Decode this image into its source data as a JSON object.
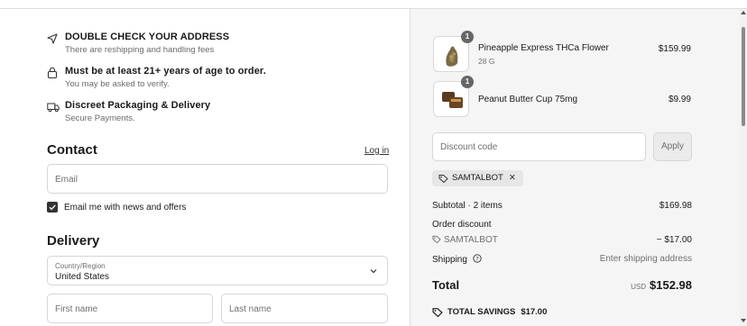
{
  "notices": [
    {
      "icon": "navigation-arrow-icon",
      "title": "DOUBLE CHECK YOUR ADDRESS",
      "subtitle": "There are reshipping and handling fees"
    },
    {
      "icon": "lock-icon",
      "title": "Must be at least 21+ years of age to order.",
      "subtitle": "You may be asked to verify."
    },
    {
      "icon": "truck-icon",
      "title": "Discreet Packaging & Delivery",
      "subtitle": "Secure Payments."
    }
  ],
  "contact": {
    "heading": "Contact",
    "login_label": "Log in",
    "email_placeholder": "Email",
    "newsletter_label": "Email me with news and offers",
    "newsletter_checked": true
  },
  "delivery": {
    "heading": "Delivery",
    "country_label": "Country/Region",
    "country_value": "United States",
    "first_name_placeholder": "First name",
    "last_name_placeholder": "Last name"
  },
  "cart": {
    "items": [
      {
        "name": "Pineapple Express THCa Flower",
        "variant": "28 G",
        "price": "$159.99",
        "quantity": "1"
      },
      {
        "name": "Peanut Butter Cup 75mg",
        "variant": "",
        "price": "$9.99",
        "quantity": "1"
      }
    ],
    "discount_placeholder": "Discount code",
    "apply_label": "Apply",
    "applied_code": "SAMTALBOT"
  },
  "summary": {
    "subtotal_label": "Subtotal · 2 items",
    "subtotal_value": "$169.98",
    "order_discount_label": "Order discount",
    "discount_code": "SAMTALBOT",
    "discount_value": "− $17.00",
    "shipping_label": "Shipping",
    "shipping_value": "Enter shipping address",
    "total_label": "Total",
    "currency": "USD",
    "total_value": "$152.98",
    "savings_label": "TOTAL SAVINGS",
    "savings_value": "$17.00"
  },
  "colors": {
    "sidebar_bg": "#f5f5f5",
    "badge_bg": "#666666",
    "checkbox_bg": "#333333"
  }
}
